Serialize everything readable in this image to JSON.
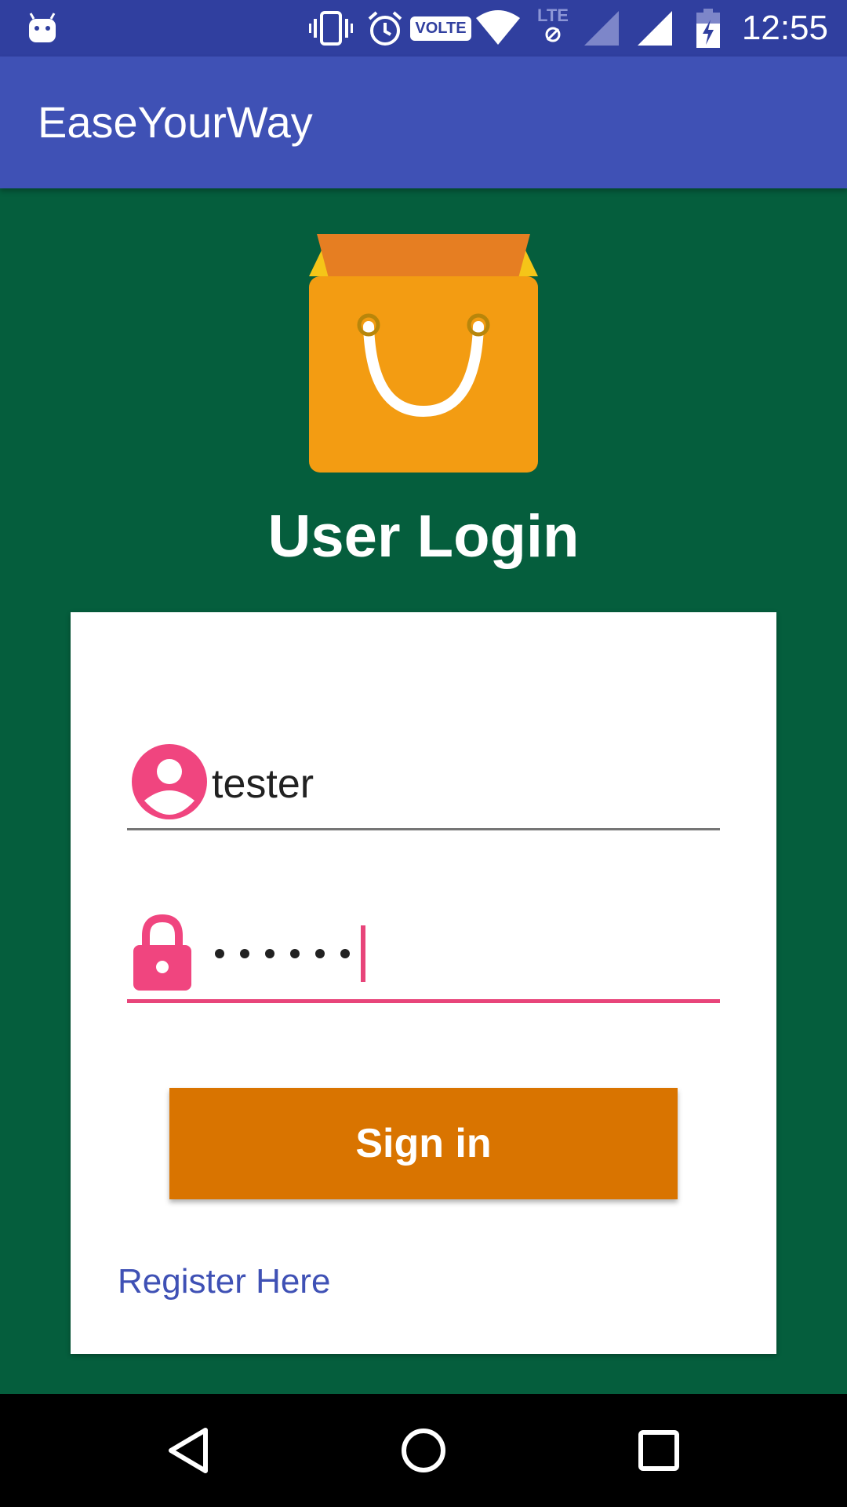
{
  "status_bar": {
    "time": "12:55",
    "volte_label": "VOLTE",
    "lte_label": "LTE",
    "icons": [
      "android-notification-icon",
      "vibrate-icon",
      "alarm-icon",
      "volte-icon",
      "wifi-icon",
      "lte-icon",
      "signal-icon",
      "signal-icon",
      "battery-charging-icon"
    ]
  },
  "app_bar": {
    "title": "EaseYourWay"
  },
  "main": {
    "logo_icon": "shopping-bag-icon",
    "heading": "User Login"
  },
  "login_form": {
    "username": {
      "icon": "person-icon",
      "value": "tester"
    },
    "password": {
      "icon": "lock-icon",
      "masked_length": 6
    },
    "signin_label": "Sign in",
    "register_label": "Register Here"
  },
  "nav_bar": {
    "icons": [
      "back-icon",
      "home-icon",
      "recents-icon"
    ]
  },
  "colors": {
    "status_bar": "#303f9f",
    "app_bar": "#3f51b5",
    "background": "#055e3d",
    "accent": "#e8457a",
    "button": "#d97400",
    "link": "#3f51b5"
  }
}
